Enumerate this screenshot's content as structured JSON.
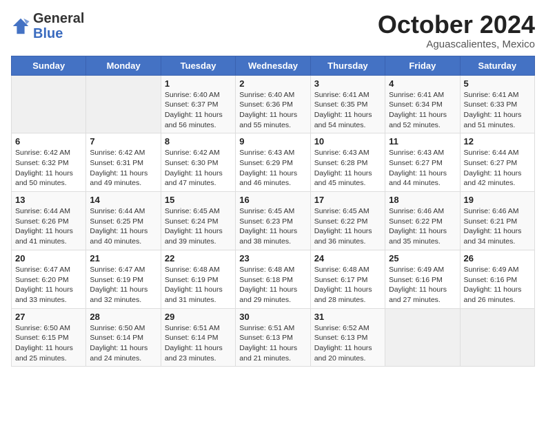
{
  "header": {
    "logo_general": "General",
    "logo_blue": "Blue",
    "month_title": "October 2024",
    "subtitle": "Aguascalientes, Mexico"
  },
  "weekdays": [
    "Sunday",
    "Monday",
    "Tuesday",
    "Wednesday",
    "Thursday",
    "Friday",
    "Saturday"
  ],
  "weeks": [
    [
      {
        "day": "",
        "info": ""
      },
      {
        "day": "",
        "info": ""
      },
      {
        "day": "1",
        "info": "Sunrise: 6:40 AM\nSunset: 6:37 PM\nDaylight: 11 hours and 56 minutes."
      },
      {
        "day": "2",
        "info": "Sunrise: 6:40 AM\nSunset: 6:36 PM\nDaylight: 11 hours and 55 minutes."
      },
      {
        "day": "3",
        "info": "Sunrise: 6:41 AM\nSunset: 6:35 PM\nDaylight: 11 hours and 54 minutes."
      },
      {
        "day": "4",
        "info": "Sunrise: 6:41 AM\nSunset: 6:34 PM\nDaylight: 11 hours and 52 minutes."
      },
      {
        "day": "5",
        "info": "Sunrise: 6:41 AM\nSunset: 6:33 PM\nDaylight: 11 hours and 51 minutes."
      }
    ],
    [
      {
        "day": "6",
        "info": "Sunrise: 6:42 AM\nSunset: 6:32 PM\nDaylight: 11 hours and 50 minutes."
      },
      {
        "day": "7",
        "info": "Sunrise: 6:42 AM\nSunset: 6:31 PM\nDaylight: 11 hours and 49 minutes."
      },
      {
        "day": "8",
        "info": "Sunrise: 6:42 AM\nSunset: 6:30 PM\nDaylight: 11 hours and 47 minutes."
      },
      {
        "day": "9",
        "info": "Sunrise: 6:43 AM\nSunset: 6:29 PM\nDaylight: 11 hours and 46 minutes."
      },
      {
        "day": "10",
        "info": "Sunrise: 6:43 AM\nSunset: 6:28 PM\nDaylight: 11 hours and 45 minutes."
      },
      {
        "day": "11",
        "info": "Sunrise: 6:43 AM\nSunset: 6:27 PM\nDaylight: 11 hours and 44 minutes."
      },
      {
        "day": "12",
        "info": "Sunrise: 6:44 AM\nSunset: 6:27 PM\nDaylight: 11 hours and 42 minutes."
      }
    ],
    [
      {
        "day": "13",
        "info": "Sunrise: 6:44 AM\nSunset: 6:26 PM\nDaylight: 11 hours and 41 minutes."
      },
      {
        "day": "14",
        "info": "Sunrise: 6:44 AM\nSunset: 6:25 PM\nDaylight: 11 hours and 40 minutes."
      },
      {
        "day": "15",
        "info": "Sunrise: 6:45 AM\nSunset: 6:24 PM\nDaylight: 11 hours and 39 minutes."
      },
      {
        "day": "16",
        "info": "Sunrise: 6:45 AM\nSunset: 6:23 PM\nDaylight: 11 hours and 38 minutes."
      },
      {
        "day": "17",
        "info": "Sunrise: 6:45 AM\nSunset: 6:22 PM\nDaylight: 11 hours and 36 minutes."
      },
      {
        "day": "18",
        "info": "Sunrise: 6:46 AM\nSunset: 6:22 PM\nDaylight: 11 hours and 35 minutes."
      },
      {
        "day": "19",
        "info": "Sunrise: 6:46 AM\nSunset: 6:21 PM\nDaylight: 11 hours and 34 minutes."
      }
    ],
    [
      {
        "day": "20",
        "info": "Sunrise: 6:47 AM\nSunset: 6:20 PM\nDaylight: 11 hours and 33 minutes."
      },
      {
        "day": "21",
        "info": "Sunrise: 6:47 AM\nSunset: 6:19 PM\nDaylight: 11 hours and 32 minutes."
      },
      {
        "day": "22",
        "info": "Sunrise: 6:48 AM\nSunset: 6:19 PM\nDaylight: 11 hours and 31 minutes."
      },
      {
        "day": "23",
        "info": "Sunrise: 6:48 AM\nSunset: 6:18 PM\nDaylight: 11 hours and 29 minutes."
      },
      {
        "day": "24",
        "info": "Sunrise: 6:48 AM\nSunset: 6:17 PM\nDaylight: 11 hours and 28 minutes."
      },
      {
        "day": "25",
        "info": "Sunrise: 6:49 AM\nSunset: 6:16 PM\nDaylight: 11 hours and 27 minutes."
      },
      {
        "day": "26",
        "info": "Sunrise: 6:49 AM\nSunset: 6:16 PM\nDaylight: 11 hours and 26 minutes."
      }
    ],
    [
      {
        "day": "27",
        "info": "Sunrise: 6:50 AM\nSunset: 6:15 PM\nDaylight: 11 hours and 25 minutes."
      },
      {
        "day": "28",
        "info": "Sunrise: 6:50 AM\nSunset: 6:14 PM\nDaylight: 11 hours and 24 minutes."
      },
      {
        "day": "29",
        "info": "Sunrise: 6:51 AM\nSunset: 6:14 PM\nDaylight: 11 hours and 23 minutes."
      },
      {
        "day": "30",
        "info": "Sunrise: 6:51 AM\nSunset: 6:13 PM\nDaylight: 11 hours and 21 minutes."
      },
      {
        "day": "31",
        "info": "Sunrise: 6:52 AM\nSunset: 6:13 PM\nDaylight: 11 hours and 20 minutes."
      },
      {
        "day": "",
        "info": ""
      },
      {
        "day": "",
        "info": ""
      }
    ]
  ]
}
